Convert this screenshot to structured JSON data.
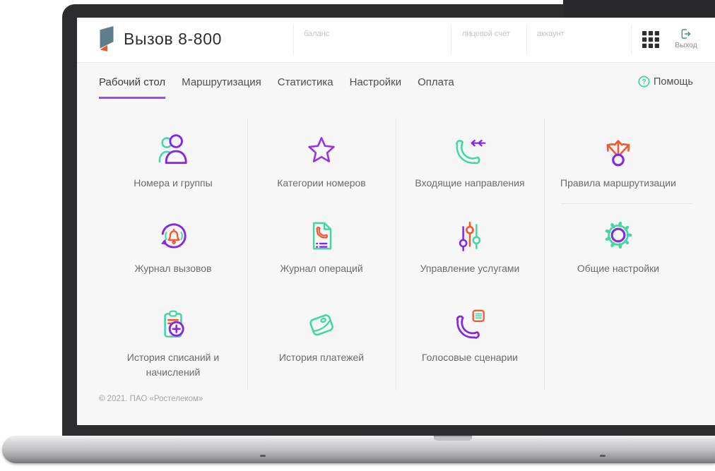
{
  "app": {
    "title": "Вызов 8-800",
    "logo_icon": "rostelecom-logo"
  },
  "header": {
    "fields": [
      {
        "label": "баланс"
      },
      {
        "label": "лицевой счет"
      },
      {
        "label": "аккаунт"
      }
    ],
    "apps_icon": "grid-apps-icon",
    "logout": {
      "label": "Выход",
      "icon": "logout-icon"
    }
  },
  "nav": {
    "tabs": [
      {
        "label": "Рабочий стол",
        "active": true
      },
      {
        "label": "Маршрутизация",
        "active": false
      },
      {
        "label": "Статистика",
        "active": false
      },
      {
        "label": "Настройки",
        "active": false
      },
      {
        "label": "Оплата",
        "active": false
      }
    ],
    "help": {
      "label": "Помощь",
      "icon": "help-icon"
    }
  },
  "main": {
    "tiles": [
      {
        "label": "Номера и группы",
        "icon": "users-icon"
      },
      {
        "label": "Категории номеров",
        "icon": "star-icon"
      },
      {
        "label": "Входящие направления",
        "icon": "incoming-call-icon"
      },
      {
        "label": "Правила маршрутизации",
        "icon": "routing-arrows-icon"
      },
      {
        "label": "Журнал вызовов",
        "icon": "call-log-bell-icon"
      },
      {
        "label": "Журнал операций",
        "icon": "operations-document-icon"
      },
      {
        "label": "Управление услугами",
        "icon": "sliders-icon"
      },
      {
        "label": "Общие настройки",
        "icon": "gear-icon"
      },
      {
        "label": "История списаний и начислений",
        "icon": "charges-history-icon"
      },
      {
        "label": "История платежей",
        "icon": "payments-wallet-icon"
      },
      {
        "label": "Голосовые сценарии",
        "icon": "voice-scenarios-icon"
      }
    ]
  },
  "footer": {
    "copyright": "© 2021. ПАО «Ростелеком»"
  },
  "colors": {
    "purple": "#8428e3",
    "green": "#42d7a4",
    "orange": "#f2592e",
    "teal": "#3f948a",
    "tab_underline": "#9b4cf3",
    "bezel": "#2d2d30",
    "screen_bg": "#f7f7f8"
  }
}
